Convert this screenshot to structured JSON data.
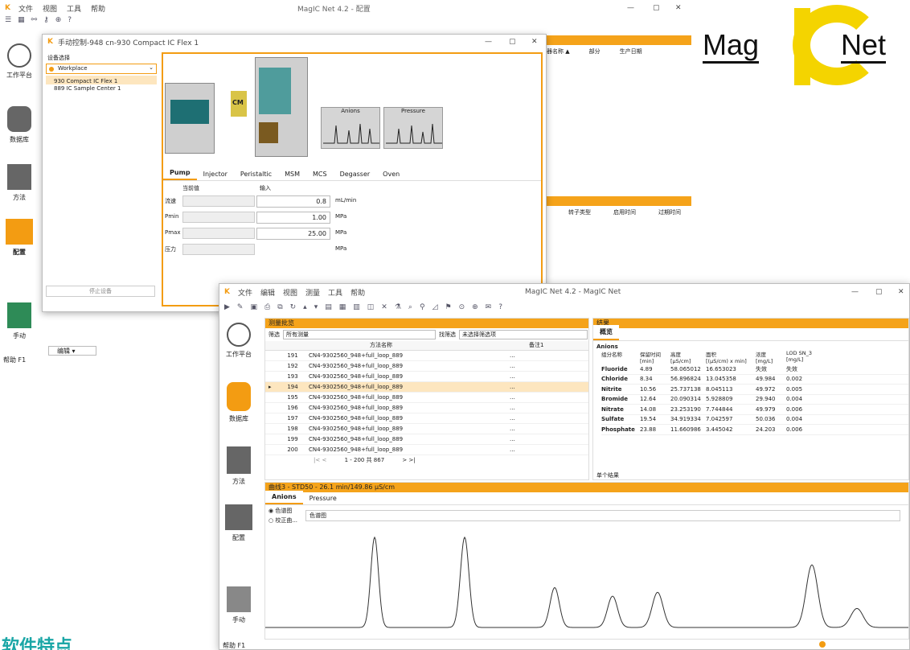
{
  "back_window": {
    "title": "MagIC Net 4.2 - 配置",
    "menu": [
      "文件",
      "视图",
      "工具",
      "帮助"
    ],
    "sidebar": [
      {
        "label": "工作平台",
        "icon": "workplace-icon"
      },
      {
        "label": "数据库",
        "icon": "database-icon"
      },
      {
        "label": "方法",
        "icon": "method-icon"
      },
      {
        "label": "配置",
        "icon": "configuration-icon"
      },
      {
        "label": "手动",
        "icon": "manual-icon"
      }
    ],
    "status": "帮助 F1",
    "edit_btn": "编辑 ▾",
    "right_table_headers": [
      "器名称 ▲",
      "部分",
      "生产日期"
    ],
    "right_table2_headers": [
      "转子类型",
      "启用时间",
      "过期时间"
    ]
  },
  "logo": {
    "part1": "Mag",
    "part2": "Net",
    "colors": {
      "yellow": "#f5d000",
      "ring": "#f2d300"
    }
  },
  "dialog": {
    "title": "手动控制-948 cn-930 Compact IC Flex 1",
    "device_label": "设备选择",
    "workplace": "Workplace",
    "devices": [
      "930 Compact IC Flex 1",
      "889 IC Sample Center 1"
    ],
    "stop_btn": "停止设备",
    "card_anions": "Anions",
    "card_pressure": "Pressure",
    "cm_label": "CM",
    "tabs": [
      "Pump",
      "Injector",
      "Peristaltic",
      "MSM",
      "MCS",
      "Degasser",
      "Oven"
    ],
    "col_current": "当前值",
    "col_input": "输入",
    "rows": [
      {
        "label": "流速",
        "value": "0.8",
        "unit": "mL/min"
      },
      {
        "label": "Pmin",
        "value": "1.00",
        "unit": "MPa"
      },
      {
        "label": "Pmax",
        "value": "25.00",
        "unit": "MPa"
      },
      {
        "label": "压力",
        "value": "",
        "unit": "MPa"
      }
    ]
  },
  "front_window": {
    "title": "MagIC Net 4.2 - MagIC Net",
    "menu": [
      "文件",
      "编辑",
      "视图",
      "测量",
      "工具",
      "帮助"
    ],
    "sidebar": [
      {
        "label": "工作平台",
        "icon": "workplace-icon"
      },
      {
        "label": "数据库",
        "icon": "database-icon"
      },
      {
        "label": "方法",
        "icon": "method-icon"
      },
      {
        "label": "配置",
        "icon": "configuration-icon"
      },
      {
        "label": "手动",
        "icon": "manual-icon"
      }
    ],
    "status": "帮助 F1",
    "meas_panel": "测量批览",
    "filter_label": "筛选",
    "filter_value": "所有测量",
    "filter2_label": "找筛选",
    "filter2_value": "未选择筛选项",
    "meas_headers": [
      "方法名称",
      "备注1"
    ],
    "meas_rows": [
      {
        "id": "191",
        "name": "CN4-9302560_948+full_loop_889"
      },
      {
        "id": "192",
        "name": "CN4-9302560_948+full_loop_889"
      },
      {
        "id": "193",
        "name": "CN4-9302560_948+full_loop_889"
      },
      {
        "id": "194",
        "name": "CN4-9302560_948+full_loop_889"
      },
      {
        "id": "195",
        "name": "CN4-9302560_948+full_loop_889"
      },
      {
        "id": "196",
        "name": "CN4-9302560_948+full_loop_889"
      },
      {
        "id": "197",
        "name": "CN4-9302560_948+full_loop_889"
      },
      {
        "id": "198",
        "name": "CN4-9302560_948+full_loop_889"
      },
      {
        "id": "199",
        "name": "CN4-9302560_948+full_loop_889"
      },
      {
        "id": "200",
        "name": "CN4-9302560_948+full_loop_889"
      }
    ],
    "pager": "1 - 200 共 867",
    "results_panel": "结果",
    "results_tab": "概览",
    "anions_group": "Anions",
    "result_headers": [
      {
        "h1": "组分名称",
        "h2": ""
      },
      {
        "h1": "保留时间",
        "h2": "[min]"
      },
      {
        "h1": "高度",
        "h2": "[µS/cm]"
      },
      {
        "h1": "面积",
        "h2": "[(µS/cm) x min]"
      },
      {
        "h1": "浓度",
        "h2": "[mg/L]"
      },
      {
        "h1": "LOD SN_3",
        "h2": "[mg/L]"
      }
    ],
    "results": [
      {
        "name": "Fluoride",
        "rt": "4.89",
        "h": "58.065012",
        "a": "16.653023",
        "c": "失效",
        "lod": "失效"
      },
      {
        "name": "Chloride",
        "rt": "8.34",
        "h": "56.896824",
        "a": "13.045358",
        "c": "49.984",
        "lod": "0.002"
      },
      {
        "name": "Nitrite",
        "rt": "10.56",
        "h": "25.737138",
        "a": "8.045113",
        "c": "49.972",
        "lod": "0.005"
      },
      {
        "name": "Bromide",
        "rt": "12.64",
        "h": "20.090314",
        "a": "5.928809",
        "c": "29.940",
        "lod": "0.004"
      },
      {
        "name": "Nitrate",
        "rt": "14.08",
        "h": "23.253190",
        "a": "7.744844",
        "c": "49.979",
        "lod": "0.006"
      },
      {
        "name": "Sulfate",
        "rt": "19.54",
        "h": "34.919334",
        "a": "7.042597",
        "c": "50.036",
        "lod": "0.004"
      },
      {
        "name": "Phosphate",
        "rt": "23.88",
        "h": "11.660986",
        "a": "3.445042",
        "c": "24.203",
        "lod": "0.006"
      }
    ],
    "results_footer": "单个结果",
    "curve_panel": "曲线3 - STD50 - 26.1 min/149.86 µS/cm",
    "curve_tabs": [
      "Anions",
      "Pressure"
    ],
    "radio1": "色谱图",
    "radio2": "校正曲...",
    "curve_select": "色谱图"
  },
  "chart_data": {
    "type": "line",
    "title": "",
    "series": [
      {
        "peaks_x": [
          0.17,
          0.31,
          0.45,
          0.54,
          0.61,
          0.85,
          0.92
        ],
        "peaks_h": [
          0.95,
          0.95,
          0.42,
          0.33,
          0.37,
          0.66,
          0.2
        ]
      }
    ]
  },
  "bottom_text": "软件特点"
}
